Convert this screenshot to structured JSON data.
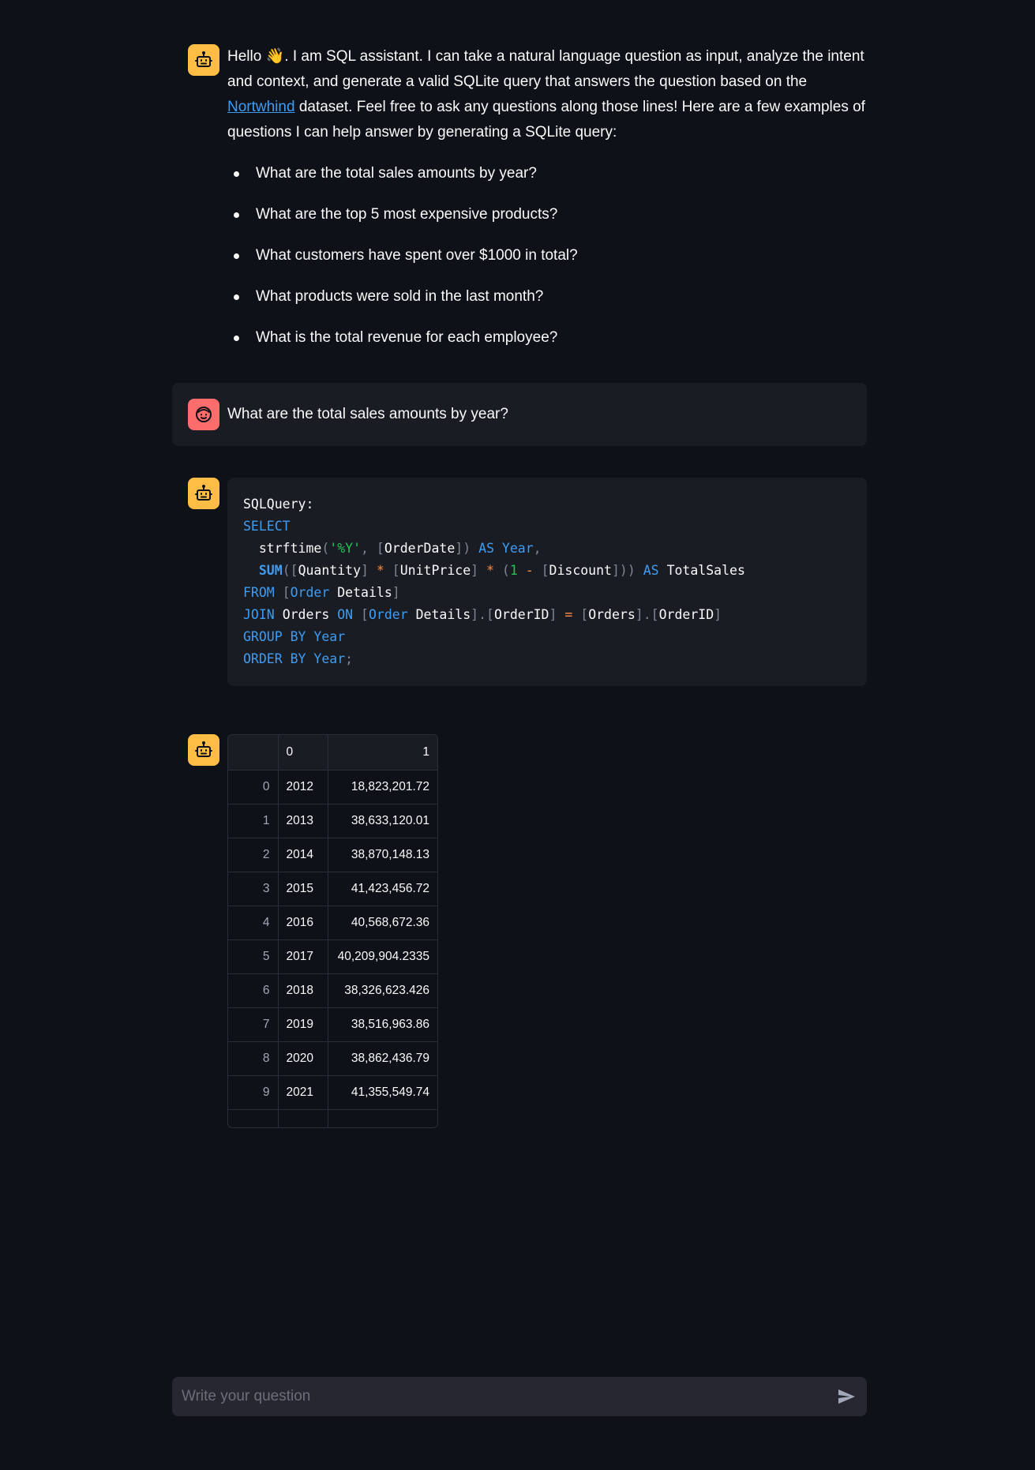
{
  "intro": {
    "greeting": "Hello",
    "wave_emoji": "👋",
    "text_before_link": ". I am SQL assistant. I can take a natural language question as input, analyze the intent and context, and generate a valid SQLite query that answers the question based on the ",
    "link_text": "Nortwhind",
    "text_after_link": " dataset. Feel free to ask any questions along those lines! Here are a few examples of questions I can help answer by generating a SQLite query:",
    "examples": [
      "What are the total sales amounts by year?",
      "What are the top 5 most expensive products?",
      "What customers have spent over $1000 in total?",
      "What products were sold in the last month?",
      "What is the total revenue for each employee?"
    ]
  },
  "user_message": "What are the total sales amounts by year?",
  "sql": {
    "label": "SQLQuery:",
    "kw_select": "SELECT",
    "fn_strftime": "strftime",
    "str_fmt": "'%Y'",
    "col_orderdate": "OrderDate",
    "kw_as": "AS",
    "alias_year": "Year",
    "fn_sum": "SUM",
    "col_quantity": "Quantity",
    "col_unitprice": "UnitPrice",
    "num_one": "1",
    "col_discount": "Discount",
    "alias_total": "TotalSales",
    "kw_from": "FROM",
    "tbl_order": "Order",
    "tbl_details": "Details",
    "kw_join": "JOIN",
    "tbl_orders": "Orders",
    "kw_on": "ON",
    "col_orderid": "OrderID",
    "kw_group_by": "GROUP BY",
    "kw_order_by": "ORDER BY"
  },
  "table": {
    "columns": [
      "",
      "0",
      "1"
    ],
    "rows": [
      [
        "0",
        "2012",
        "18,823,201.72"
      ],
      [
        "1",
        "2013",
        "38,633,120.01"
      ],
      [
        "2",
        "2014",
        "38,870,148.13"
      ],
      [
        "3",
        "2015",
        "41,423,456.72"
      ],
      [
        "4",
        "2016",
        "40,568,672.36"
      ],
      [
        "5",
        "2017",
        "40,209,904.2335"
      ],
      [
        "6",
        "2018",
        "38,326,623.426"
      ],
      [
        "7",
        "2019",
        "38,516,963.86"
      ],
      [
        "8",
        "2020",
        "38,862,436.79"
      ],
      [
        "9",
        "2021",
        "41,355,549.74"
      ]
    ]
  },
  "input": {
    "placeholder": "Write your question"
  },
  "colors": {
    "background": "#0e1117",
    "bot_avatar": "#ffbd45",
    "user_avatar": "#ff6c6c",
    "link": "#3d9df3",
    "keyword": "#3d9df3",
    "string": "#21c354",
    "operator": "#ff8c43"
  },
  "icons": {
    "bot_avatar": "robot-face-icon",
    "user_avatar": "smiley-face-icon",
    "send": "send-arrow-icon"
  }
}
